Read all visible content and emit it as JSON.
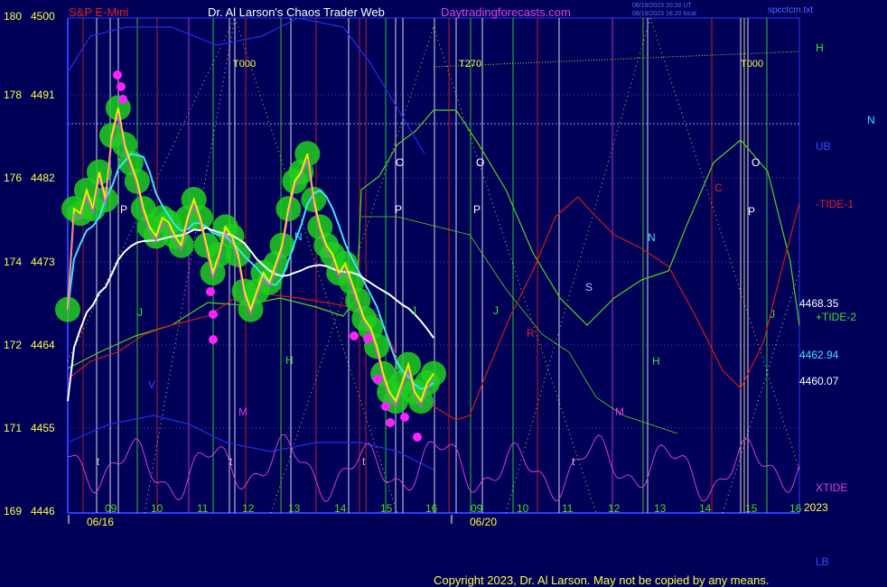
{
  "header": {
    "symbol": "S&P E-Mini",
    "title": "Dr. Al Larson's Chaos Trader Web",
    "site": "Daytradingforecasts.com",
    "stamp1": "06/19/2023 20:20 UT",
    "stamp2": "06/19/2023 16:20 local",
    "file": "spcctcm.txt"
  },
  "copyright": "Copyright 2023, Dr. Al Larson. May not be copied by any means.",
  "colors": {
    "background": "#000058",
    "axis": "#2a3cff",
    "grid": "#4a4ab4",
    "price": "#f2f200",
    "blob": "#1fcf1f",
    "cyan": "#3fe0ff",
    "white": "#ffffff",
    "xtide": "#d93ad9",
    "tide1": "#d01a1a",
    "tide2": "#4cd61e",
    "blue": "#2230e6"
  },
  "chart_data": {
    "type": "line",
    "y_axis": {
      "labels": [
        {
          "left": "180",
          "right": "4500"
        },
        {
          "left": "178",
          "right": "4491"
        },
        {
          "left": "176",
          "right": "4482"
        },
        {
          "left": "174",
          "right": "4473"
        },
        {
          "left": "172",
          "right": "4464"
        },
        {
          "left": "171",
          "right": "4455"
        },
        {
          "left": "169",
          "right": "4446"
        }
      ],
      "ylim": [
        4446,
        4500
      ]
    },
    "x_axis": {
      "hour_labels": [
        "09",
        "10",
        "11",
        "12",
        "13",
        "14",
        "15",
        "16",
        "09",
        "10",
        "11",
        "12",
        "13",
        "14",
        "15",
        "16"
      ],
      "dates": [
        "06/16",
        "06/20"
      ],
      "year": "2023"
    },
    "right_labels": {
      "h": "H",
      "n": "N",
      "ub": "UB",
      "tide1": "-TIDE-1",
      "v1": "4468.35",
      "tide2": "+TIDE-2",
      "v2": "4462.94",
      "v3": "4460.07",
      "xtide": "XTIDE",
      "lb": "LB"
    },
    "cycle_labels": [
      "T000",
      "T270",
      "T000"
    ],
    "markers": [
      "O",
      "O",
      "O",
      "P",
      "P",
      "P",
      "P",
      "N",
      "N",
      "S",
      "C",
      "R",
      "H",
      "H",
      "J",
      "J",
      "J",
      "J",
      "M",
      "M",
      "V",
      "t",
      "t",
      "t",
      "t"
    ],
    "series": [
      {
        "name": "S&P E-Mini",
        "values": [
          4468.0,
          4479.0,
          4478.5,
          4481.0,
          4479.0,
          4483.0,
          4480.0,
          4487.0,
          4490.0,
          4486.0,
          4484.0,
          4482.0,
          4479.0,
          4477.0,
          4476.0,
          4478.0,
          4477.5,
          4476.0,
          4475.0,
          4478.0,
          4480.0,
          4478.0,
          4475.0,
          4472.0,
          4474.0,
          4477.0,
          4476.0,
          4474.0,
          4470.0,
          4468.0,
          4470.0,
          4472.0,
          4471.0,
          4473.0,
          4475.0,
          4479.0,
          4482.0,
          4483.0,
          4485.0,
          4480.0,
          4477.0,
          4475.0,
          4474.0,
          4472.0,
          4473.0,
          4471.0,
          4469.0,
          4467.0,
          4466.0,
          4464.0,
          4461.0,
          4459.0,
          4458.0,
          4460.0,
          4462.0,
          4459.0,
          4458.0,
          4460.0,
          4461.0
        ]
      },
      {
        "name": "-TIDE-1"
      },
      {
        "name": "+TIDE-2"
      },
      {
        "name": "XTIDE"
      }
    ]
  }
}
